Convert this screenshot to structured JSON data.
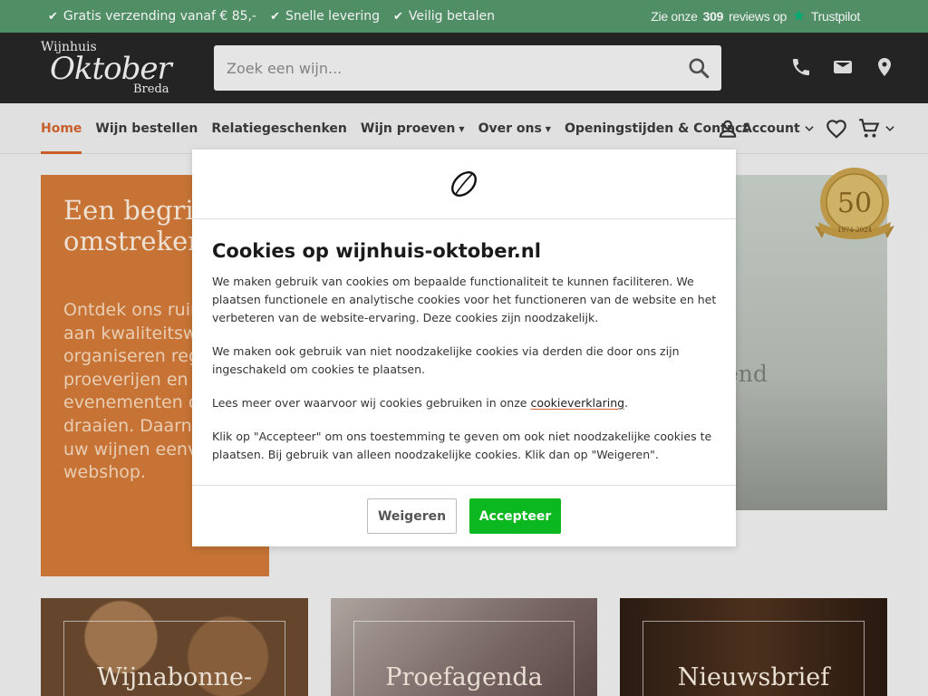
{
  "topbar": {
    "usps": [
      {
        "label": "Gratis verzending vanaf € 85,-"
      },
      {
        "label": "Snelle levering"
      },
      {
        "label": "Veilig betalen"
      }
    ],
    "trust_prefix": "Zie onze",
    "trust_count": "309",
    "trust_suffix": "reviews op",
    "trust_brand": "Trustpilot"
  },
  "logo": {
    "line1": "Wijnhuis",
    "line2": "Oktober",
    "line3": "Breda"
  },
  "search": {
    "placeholder": "Zoek een wijn..."
  },
  "nav": {
    "items": [
      {
        "label": "Home"
      },
      {
        "label": "Wijn bestellen"
      },
      {
        "label": "Relatiegeschenken"
      },
      {
        "label": "Wijn proeven"
      },
      {
        "label": "Over ons"
      },
      {
        "label": "Openingstijden & Contact"
      }
    ],
    "account_label": "Account"
  },
  "hero": {
    "title": "Een begrip in Breda en omstreken",
    "text": "Ontdek ons ruim assortiment aan kwaliteitswijnen. We organiseren regelmatig proeverijen en andere evenementen die om wijn draaien. Daarnaast bestel je uw wijnen eenvoudig in onze webshop.",
    "image_fragment": "end",
    "badge_number": "50",
    "badge_years": "1974-2024"
  },
  "tiles": [
    {
      "label": "Wijnabonne-"
    },
    {
      "label": "Proefagenda"
    },
    {
      "label": "Nieuwsbrief"
    }
  ],
  "cookie": {
    "title": "Cookies op wijnhuis-oktober.nl",
    "p1": "We maken gebruik van cookies om bepaalde functionaliteit te kunnen faciliteren. We plaatsen functionele en analytische cookies voor het functioneren van de website en het verbeteren van de website-ervaring. Deze cookies zijn noodzakelijk.",
    "p2": "We maken ook gebruik van niet noodzakelijke cookies via derden die door ons zijn ingeschakeld om cookies te plaatsen.",
    "p3_prefix": "Lees meer over waarvoor wij cookies gebruiken in onze",
    "p3_link": "cookieverklaring",
    "p3_suffix": ".",
    "p4": "Klik op \"Accepteer\" om ons toestemming te geven om ook niet noodzakelijke cookies te plaatsen. Bij gebruik van alleen noodzakelijke cookies. Klik dan op \"Weigeren\".",
    "refuse_label": "Weigeren",
    "accept_label": "Accepteer"
  },
  "colors": {
    "topbar": "#55966c",
    "header": "#262626",
    "accent": "#d3642e",
    "hero_orange": "#d17a38",
    "accept_green": "#0bb820",
    "trustpilot_star": "#00b67a"
  },
  "icons": [
    "check-icon",
    "trustpilot-star-icon",
    "search-icon",
    "phone-icon",
    "mail-icon",
    "location-icon",
    "user-icon",
    "chevron-down-icon",
    "heart-icon",
    "cart-icon"
  ]
}
